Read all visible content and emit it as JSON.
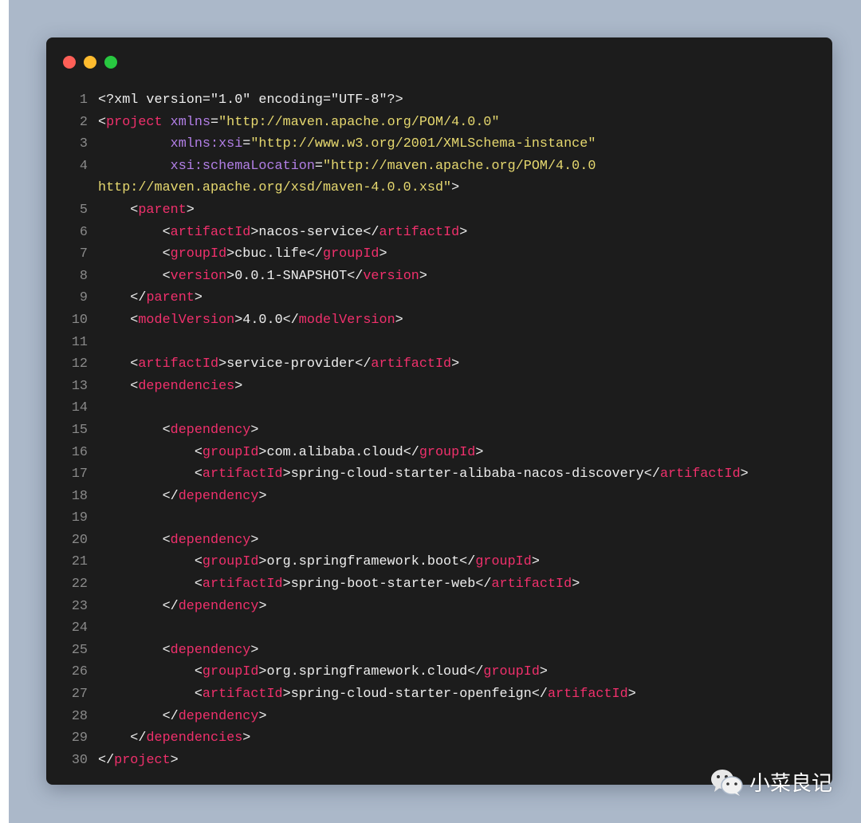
{
  "window": {
    "controls": [
      "close",
      "minimize",
      "maximize"
    ],
    "colors": {
      "close": "#fe5f57",
      "minimize": "#febb2e",
      "maximize": "#28c840"
    }
  },
  "code": {
    "lines": [
      {
        "n": "1",
        "tokens": [
          [
            "p",
            "<?xml version=\"1.0\" encoding=\"UTF-8\"?>"
          ]
        ]
      },
      {
        "n": "2",
        "tokens": [
          [
            "p",
            "<"
          ],
          [
            "t",
            "project"
          ],
          [
            "p",
            " "
          ],
          [
            "a",
            "xmlns"
          ],
          [
            "p",
            "="
          ],
          [
            "s",
            "\"http://maven.apache.org/POM/4.0.0\""
          ]
        ]
      },
      {
        "n": "3",
        "tokens": [
          [
            "p",
            "         "
          ],
          [
            "a",
            "xmlns:xsi"
          ],
          [
            "p",
            "="
          ],
          [
            "s",
            "\"http://www.w3.org/2001/XMLSchema-instance\""
          ]
        ]
      },
      {
        "n": "4",
        "tokens": [
          [
            "p",
            "         "
          ],
          [
            "a",
            "xsi:schemaLocation"
          ],
          [
            "p",
            "="
          ],
          [
            "s",
            "\"http://maven.apache.org/POM/4.0.0"
          ]
        ]
      },
      {
        "n": "",
        "tokens": [
          [
            "s",
            "http://maven.apache.org/xsd/maven-4.0.0.xsd\""
          ],
          [
            "p",
            ">"
          ]
        ]
      },
      {
        "n": "5",
        "tokens": [
          [
            "p",
            "    <"
          ],
          [
            "t",
            "parent"
          ],
          [
            "p",
            ">"
          ]
        ]
      },
      {
        "n": "6",
        "tokens": [
          [
            "p",
            "        <"
          ],
          [
            "t",
            "artifactId"
          ],
          [
            "p",
            ">nacos-service</"
          ],
          [
            "t",
            "artifactId"
          ],
          [
            "p",
            ">"
          ]
        ]
      },
      {
        "n": "7",
        "tokens": [
          [
            "p",
            "        <"
          ],
          [
            "t",
            "groupId"
          ],
          [
            "p",
            ">cbuc.life</"
          ],
          [
            "t",
            "groupId"
          ],
          [
            "p",
            ">"
          ]
        ]
      },
      {
        "n": "8",
        "tokens": [
          [
            "p",
            "        <"
          ],
          [
            "t",
            "version"
          ],
          [
            "p",
            ">0.0.1-SNAPSHOT</"
          ],
          [
            "t",
            "version"
          ],
          [
            "p",
            ">"
          ]
        ]
      },
      {
        "n": "9",
        "tokens": [
          [
            "p",
            "    </"
          ],
          [
            "t",
            "parent"
          ],
          [
            "p",
            ">"
          ]
        ]
      },
      {
        "n": "10",
        "tokens": [
          [
            "p",
            "    <"
          ],
          [
            "t",
            "modelVersion"
          ],
          [
            "p",
            ">4.0.0</"
          ],
          [
            "t",
            "modelVersion"
          ],
          [
            "p",
            ">"
          ]
        ]
      },
      {
        "n": "11",
        "tokens": []
      },
      {
        "n": "12",
        "tokens": [
          [
            "p",
            "    <"
          ],
          [
            "t",
            "artifactId"
          ],
          [
            "p",
            ">service-provider</"
          ],
          [
            "t",
            "artifactId"
          ],
          [
            "p",
            ">"
          ]
        ]
      },
      {
        "n": "13",
        "tokens": [
          [
            "p",
            "    <"
          ],
          [
            "t",
            "dependencies"
          ],
          [
            "p",
            ">"
          ]
        ]
      },
      {
        "n": "14",
        "tokens": []
      },
      {
        "n": "15",
        "tokens": [
          [
            "p",
            "        <"
          ],
          [
            "t",
            "dependency"
          ],
          [
            "p",
            ">"
          ]
        ]
      },
      {
        "n": "16",
        "tokens": [
          [
            "p",
            "            <"
          ],
          [
            "t",
            "groupId"
          ],
          [
            "p",
            ">com.alibaba.cloud</"
          ],
          [
            "t",
            "groupId"
          ],
          [
            "p",
            ">"
          ]
        ]
      },
      {
        "n": "17",
        "tokens": [
          [
            "p",
            "            <"
          ],
          [
            "t",
            "artifactId"
          ],
          [
            "p",
            ">spring-cloud-starter-alibaba-nacos-discovery</"
          ],
          [
            "t",
            "artifactId"
          ],
          [
            "p",
            ">"
          ]
        ]
      },
      {
        "n": "18",
        "tokens": [
          [
            "p",
            "        </"
          ],
          [
            "t",
            "dependency"
          ],
          [
            "p",
            ">"
          ]
        ]
      },
      {
        "n": "19",
        "tokens": []
      },
      {
        "n": "20",
        "tokens": [
          [
            "p",
            "        <"
          ],
          [
            "t",
            "dependency"
          ],
          [
            "p",
            ">"
          ]
        ]
      },
      {
        "n": "21",
        "tokens": [
          [
            "p",
            "            <"
          ],
          [
            "t",
            "groupId"
          ],
          [
            "p",
            ">org.springframework.boot</"
          ],
          [
            "t",
            "groupId"
          ],
          [
            "p",
            ">"
          ]
        ]
      },
      {
        "n": "22",
        "tokens": [
          [
            "p",
            "            <"
          ],
          [
            "t",
            "artifactId"
          ],
          [
            "p",
            ">spring-boot-starter-web</"
          ],
          [
            "t",
            "artifactId"
          ],
          [
            "p",
            ">"
          ]
        ]
      },
      {
        "n": "23",
        "tokens": [
          [
            "p",
            "        </"
          ],
          [
            "t",
            "dependency"
          ],
          [
            "p",
            ">"
          ]
        ]
      },
      {
        "n": "24",
        "tokens": []
      },
      {
        "n": "25",
        "tokens": [
          [
            "p",
            "        <"
          ],
          [
            "t",
            "dependency"
          ],
          [
            "p",
            ">"
          ]
        ]
      },
      {
        "n": "26",
        "tokens": [
          [
            "p",
            "            <"
          ],
          [
            "t",
            "groupId"
          ],
          [
            "p",
            ">org.springframework.cloud</"
          ],
          [
            "t",
            "groupId"
          ],
          [
            "p",
            ">"
          ]
        ]
      },
      {
        "n": "27",
        "tokens": [
          [
            "p",
            "            <"
          ],
          [
            "t",
            "artifactId"
          ],
          [
            "p",
            ">spring-cloud-starter-openfeign</"
          ],
          [
            "t",
            "artifactId"
          ],
          [
            "p",
            ">"
          ]
        ]
      },
      {
        "n": "28",
        "tokens": [
          [
            "p",
            "        </"
          ],
          [
            "t",
            "dependency"
          ],
          [
            "p",
            ">"
          ]
        ]
      },
      {
        "n": "29",
        "tokens": [
          [
            "p",
            "    </"
          ],
          [
            "t",
            "dependencies"
          ],
          [
            "p",
            ">"
          ]
        ]
      },
      {
        "n": "30",
        "tokens": [
          [
            "p",
            "</"
          ],
          [
            "t",
            "project"
          ],
          [
            "p",
            ">"
          ]
        ]
      }
    ]
  },
  "watermark": {
    "icon": "wechat-icon",
    "text": "小菜良记"
  }
}
